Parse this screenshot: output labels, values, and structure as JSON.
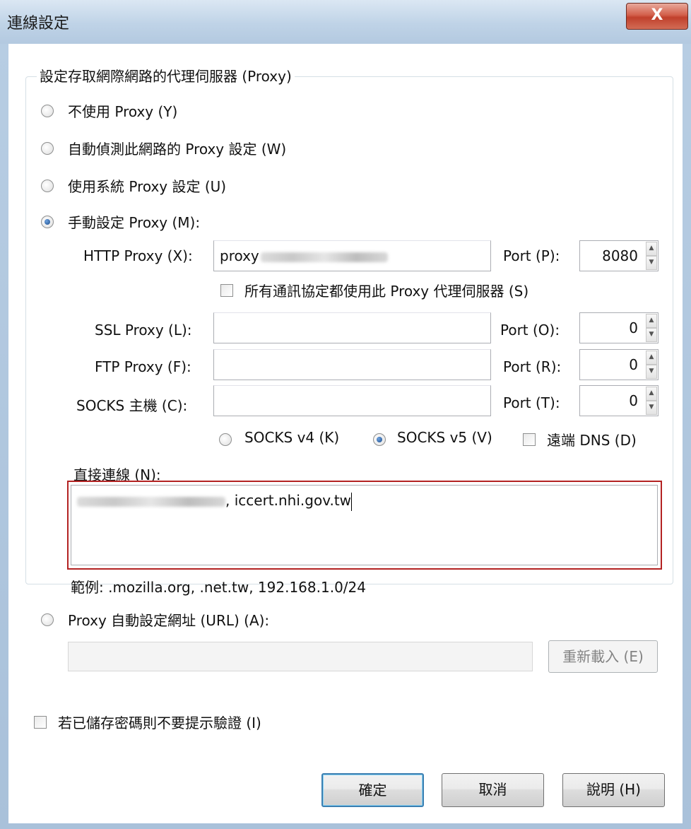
{
  "window": {
    "title": "連線設定",
    "close_label": "X"
  },
  "group": {
    "legend": "設定存取網際網路的代理伺服器 (Proxy)"
  },
  "radios": {
    "no_proxy": "不使用 Proxy (Y)",
    "auto_detect": "自動偵測此網路的 Proxy 設定 (W)",
    "system": "使用系統 Proxy 設定 (U)",
    "manual": "手動設定 Proxy (M):",
    "pac": "Proxy 自動設定網址 (URL) (A):"
  },
  "http": {
    "label": "HTTP Proxy (X):",
    "value": "proxy",
    "port_label": "Port (P):",
    "port": "8080"
  },
  "share": {
    "label": "所有通訊協定都使用此 Proxy 代理伺服器 (S)"
  },
  "ssl": {
    "label": "SSL Proxy (L):",
    "value": "",
    "port_label": "Port (O):",
    "port": "0"
  },
  "ftp": {
    "label": "FTP Proxy (F):",
    "value": "",
    "port_label": "Port (R):",
    "port": "0"
  },
  "socks": {
    "label": "SOCKS 主機 (C):",
    "value": "",
    "port_label": "Port (T):",
    "port": "0"
  },
  "socks_version": {
    "v4": "SOCKS v4 (K)",
    "v5": "SOCKS v5 (V)",
    "remote_dns": "遠端 DNS (D)"
  },
  "no_proxy_for": {
    "label": "直接連線 (N):",
    "value": ", iccert.nhi.gov.tw",
    "example": "範例: .mozilla.org, .net.tw, 192.168.1.0/24"
  },
  "pac": {
    "url": "",
    "reload_label": "重新載入 (E)"
  },
  "auth": {
    "label": "若已儲存密碼則不要提示驗證 (I)"
  },
  "buttons": {
    "ok": "確定",
    "cancel": "取消",
    "help": "說明 (H)"
  }
}
